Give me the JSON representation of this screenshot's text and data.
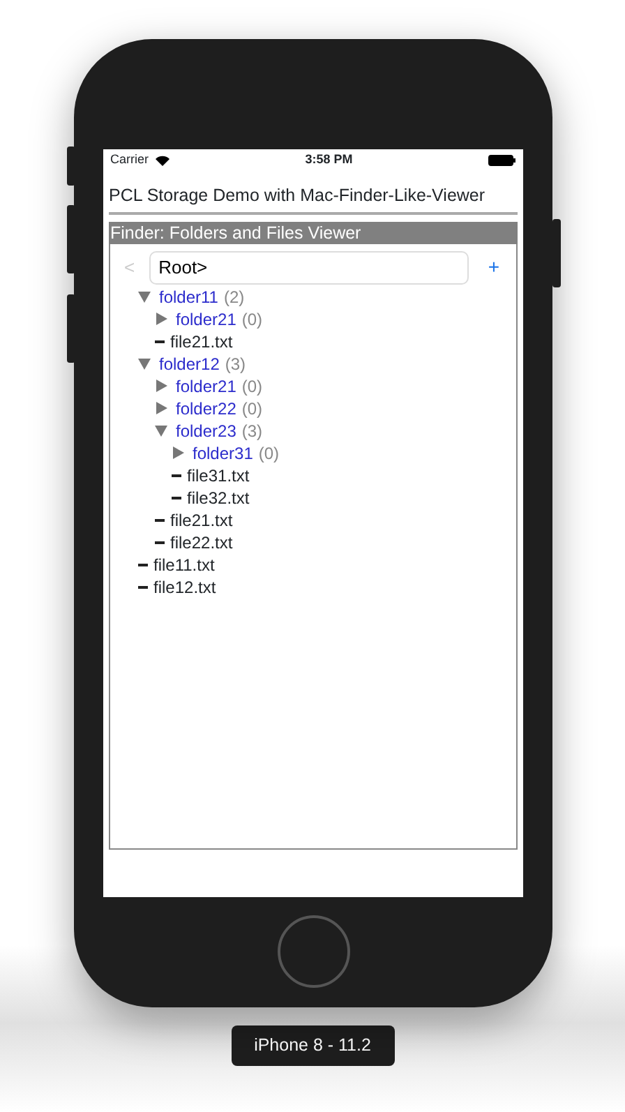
{
  "device_label": "iPhone 8 - 11.2",
  "status_bar": {
    "carrier": "Carrier",
    "time": "3:58 PM"
  },
  "title": "PCL Storage Demo with Mac-Finder-Like-Viewer",
  "finder": {
    "header": "Finder: Folders and Files Viewer",
    "back_button": "<",
    "path_field": {
      "value": "Root>"
    },
    "add_button": "+",
    "tree": [
      {
        "kind": "folder",
        "name": "folder11",
        "count": "(2)",
        "expanded": true,
        "children": [
          {
            "kind": "folder",
            "name": "folder21",
            "count": "(0)",
            "expanded": false
          },
          {
            "kind": "file",
            "name": "file21.txt"
          }
        ]
      },
      {
        "kind": "folder",
        "name": "folder12",
        "count": "(3)",
        "expanded": true,
        "children": [
          {
            "kind": "folder",
            "name": "folder21",
            "count": "(0)",
            "expanded": false
          },
          {
            "kind": "folder",
            "name": "folder22",
            "count": "(0)",
            "expanded": false
          },
          {
            "kind": "folder",
            "name": "folder23",
            "count": "(3)",
            "expanded": true,
            "children": [
              {
                "kind": "folder",
                "name": "folder31",
                "count": "(0)",
                "expanded": false
              },
              {
                "kind": "file",
                "name": "file31.txt"
              },
              {
                "kind": "file",
                "name": "file32.txt"
              }
            ]
          },
          {
            "kind": "file",
            "name": "file21.txt"
          },
          {
            "kind": "file",
            "name": "file22.txt"
          }
        ]
      },
      {
        "kind": "file",
        "name": "file11.txt"
      },
      {
        "kind": "file",
        "name": "file12.txt"
      }
    ]
  }
}
